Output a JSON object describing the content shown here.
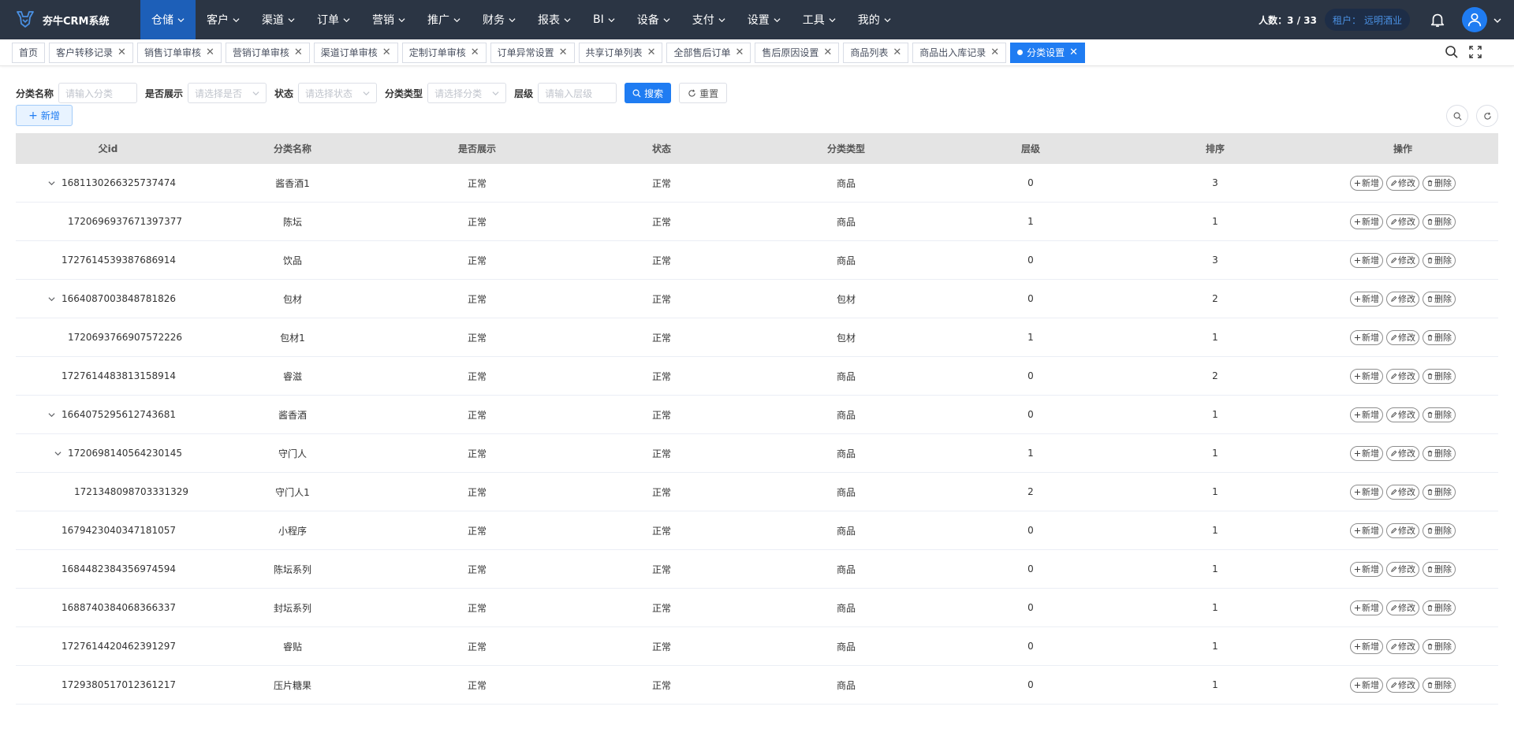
{
  "app": {
    "title": "夯牛CRM系统"
  },
  "menu": [
    {
      "label": "仓储",
      "active": true
    },
    {
      "label": "客户"
    },
    {
      "label": "渠道"
    },
    {
      "label": "订单"
    },
    {
      "label": "营销"
    },
    {
      "label": "推广"
    },
    {
      "label": "财务"
    },
    {
      "label": "报表"
    },
    {
      "label": "BI"
    },
    {
      "label": "设备"
    },
    {
      "label": "支付"
    },
    {
      "label": "设置"
    },
    {
      "label": "工具"
    },
    {
      "label": "我的"
    }
  ],
  "header": {
    "people": "人数：3 / 33",
    "tenant_label": "租户：",
    "tenant_name": "远明酒业"
  },
  "tabs": [
    {
      "label": "首页",
      "closable": false
    },
    {
      "label": "客户转移记录",
      "closable": true
    },
    {
      "label": "销售订单审核",
      "closable": true
    },
    {
      "label": "营销订单审核",
      "closable": true
    },
    {
      "label": "渠道订单审核",
      "closable": true
    },
    {
      "label": "定制订单审核",
      "closable": true
    },
    {
      "label": "订单异常设置",
      "closable": true
    },
    {
      "label": "共享订单列表",
      "closable": true
    },
    {
      "label": "全部售后订单",
      "closable": true
    },
    {
      "label": "售后原因设置",
      "closable": true
    },
    {
      "label": "商品列表",
      "closable": true
    },
    {
      "label": "商品出入库记录",
      "closable": true
    },
    {
      "label": "分类设置",
      "closable": true,
      "active": true
    }
  ],
  "search": {
    "name_label": "分类名称",
    "name_placeholder": "请输入分类",
    "show_label": "是否展示",
    "show_placeholder": "请选择是否",
    "status_label": "状态",
    "status_placeholder": "请选择状态",
    "type_label": "分类类型",
    "type_placeholder": "请选择分类",
    "level_label": "层级",
    "level_placeholder": "请输入层级",
    "search_btn": "搜索",
    "reset_btn": "重置"
  },
  "toolbar": {
    "add_label": "新增"
  },
  "table": {
    "columns": [
      "父id",
      "分类名称",
      "是否展示",
      "状态",
      "分类类型",
      "层级",
      "排序",
      "操作"
    ],
    "actions": {
      "add": "新增",
      "edit": "修改",
      "delete": "删除"
    },
    "rows": [
      {
        "id": "1681130266325737474",
        "name": "酱香酒1",
        "show": "正常",
        "status": "正常",
        "type": "商品",
        "level": "0",
        "sort": "3",
        "depth": 0,
        "expandable": true
      },
      {
        "id": "1720696937671397377",
        "name": "陈坛",
        "show": "正常",
        "status": "正常",
        "type": "商品",
        "level": "1",
        "sort": "1",
        "depth": 1,
        "expandable": false
      },
      {
        "id": "1727614539387686914",
        "name": "饮品",
        "show": "正常",
        "status": "正常",
        "type": "商品",
        "level": "0",
        "sort": "3",
        "depth": 0,
        "expandable": false
      },
      {
        "id": "1664087003848781826",
        "name": "包材",
        "show": "正常",
        "status": "正常",
        "type": "包材",
        "level": "0",
        "sort": "2",
        "depth": 0,
        "expandable": true
      },
      {
        "id": "1720693766907572226",
        "name": "包材1",
        "show": "正常",
        "status": "正常",
        "type": "包材",
        "level": "1",
        "sort": "1",
        "depth": 1,
        "expandable": false
      },
      {
        "id": "1727614483813158914",
        "name": "睿滋",
        "show": "正常",
        "status": "正常",
        "type": "商品",
        "level": "0",
        "sort": "2",
        "depth": 0,
        "expandable": false
      },
      {
        "id": "1664075295612743681",
        "name": "酱香酒",
        "show": "正常",
        "status": "正常",
        "type": "商品",
        "level": "0",
        "sort": "1",
        "depth": 0,
        "expandable": true
      },
      {
        "id": "1720698140564230145",
        "name": "守门人",
        "show": "正常",
        "status": "正常",
        "type": "商品",
        "level": "1",
        "sort": "1",
        "depth": 1,
        "expandable": true
      },
      {
        "id": "1721348098703331329",
        "name": "守门人1",
        "show": "正常",
        "status": "正常",
        "type": "商品",
        "level": "2",
        "sort": "1",
        "depth": 2,
        "expandable": false
      },
      {
        "id": "1679423040347181057",
        "name": "小程序",
        "show": "正常",
        "status": "正常",
        "type": "商品",
        "level": "0",
        "sort": "1",
        "depth": 0,
        "expandable": false
      },
      {
        "id": "1684482384356974594",
        "name": "陈坛系列",
        "show": "正常",
        "status": "正常",
        "type": "商品",
        "level": "0",
        "sort": "1",
        "depth": 0,
        "expandable": false
      },
      {
        "id": "1688740384068366337",
        "name": "封坛系列",
        "show": "正常",
        "status": "正常",
        "type": "商品",
        "level": "0",
        "sort": "1",
        "depth": 0,
        "expandable": false
      },
      {
        "id": "1727614420462391297",
        "name": "睿贴",
        "show": "正常",
        "status": "正常",
        "type": "商品",
        "level": "0",
        "sort": "1",
        "depth": 0,
        "expandable": false
      },
      {
        "id": "1729380517012361217",
        "name": "压片糖果",
        "show": "正常",
        "status": "正常",
        "type": "商品",
        "level": "0",
        "sort": "1",
        "depth": 0,
        "expandable": false
      }
    ]
  },
  "icons": {
    "logo": "bull-logo-icon",
    "bell": "bell-icon",
    "avatar": "user-avatar-icon",
    "search": "search-icon",
    "fullscreen": "fullscreen-icon",
    "refresh": "refresh-icon",
    "chevron": "chevron-down-icon"
  },
  "colors": {
    "topbar": "#2b3544",
    "menu_active": "#1d5fb8",
    "primary": "#1f7cf2",
    "table_header": "#e4e4e4"
  }
}
